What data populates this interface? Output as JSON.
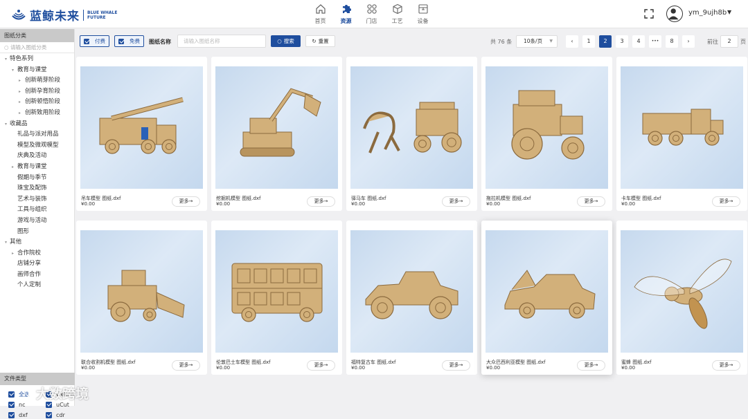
{
  "brand": {
    "name_cn": "蓝鲸未来",
    "name_en_line1": "BLUE WHALE",
    "name_en_line2": "FUTURE",
    "color": "#1f4e9e"
  },
  "nav": [
    {
      "label": "首页",
      "icon": "home-icon"
    },
    {
      "label": "资源",
      "icon": "puzzle-icon",
      "active": true
    },
    {
      "label": "门店",
      "icon": "grid-icon"
    },
    {
      "label": "工艺",
      "icon": "cube-icon"
    },
    {
      "label": "设备",
      "icon": "machine-icon"
    }
  ],
  "user": {
    "name": "ym_9ujh8b"
  },
  "sidebar": {
    "header": "图纸分类",
    "search_placeholder": "请输入图纸分类",
    "tree": [
      {
        "label": "特色系列",
        "level": 0,
        "toggle": "▾"
      },
      {
        "label": "教育与课堂",
        "level": 1,
        "toggle": "▾"
      },
      {
        "label": "创新萌芽阶段",
        "level": 2,
        "toggle": "▸"
      },
      {
        "label": "创新孕育阶段",
        "level": 2,
        "toggle": "▸"
      },
      {
        "label": "创新顿悟阶段",
        "level": 2,
        "toggle": "▸"
      },
      {
        "label": "创新致用阶段",
        "level": 2,
        "toggle": "▸"
      },
      {
        "label": "收藏品",
        "level": 0,
        "toggle": "▾"
      },
      {
        "label": "礼品与派对用品",
        "level": 1,
        "toggle": ""
      },
      {
        "label": "模型及微观模型",
        "level": 1,
        "toggle": ""
      },
      {
        "label": "庆典及活动",
        "level": 1,
        "toggle": ""
      },
      {
        "label": "教育与课堂",
        "level": 1,
        "toggle": "▸"
      },
      {
        "label": "假期与季节",
        "level": 1,
        "toggle": ""
      },
      {
        "label": "珠宝及配饰",
        "level": 1,
        "toggle": ""
      },
      {
        "label": "艺术与装饰",
        "level": 1,
        "toggle": ""
      },
      {
        "label": "工具与组织",
        "level": 1,
        "toggle": ""
      },
      {
        "label": "游戏与活动",
        "level": 1,
        "toggle": ""
      },
      {
        "label": "图形",
        "level": 1,
        "toggle": ""
      },
      {
        "label": "其他",
        "level": 0,
        "toggle": "▾"
      },
      {
        "label": "合作院校",
        "level": 1,
        "toggle": "▸"
      },
      {
        "label": "店铺分享",
        "level": 1,
        "toggle": ""
      },
      {
        "label": "画师合作",
        "level": 1,
        "toggle": ""
      },
      {
        "label": "个人定制",
        "level": 1,
        "toggle": ""
      }
    ],
    "file_type_header": "文件类型",
    "file_types": [
      "全选",
      "websm",
      "nc",
      "uCut",
      "dxf",
      "cdr"
    ]
  },
  "filters": {
    "paid_label": "付费",
    "free_label": "免费",
    "name_label": "图纸名称",
    "name_placeholder": "请输入图纸名称",
    "search_label": "搜索",
    "reset_label": "重置"
  },
  "pagination": {
    "total_text": "共 76 条",
    "page_size": "10条/页",
    "prev": "‹",
    "next": "›",
    "pages": [
      "1",
      "2",
      "3",
      "4",
      "•••",
      "8"
    ],
    "current": "2",
    "goto_label": "前往",
    "goto_value": "2",
    "page_suffix": "页"
  },
  "cards": [
    {
      "title": "吊车模型 图纸.dxf",
      "price": "¥0.00",
      "more": "更多→",
      "art": "crane"
    },
    {
      "title": "挖掘机模型 图纸.dxf",
      "price": "¥0.00",
      "more": "更多→",
      "art": "excavator"
    },
    {
      "title": "驿马车 图纸.dxf",
      "price": "¥0.00",
      "more": "更多→",
      "art": "carriage"
    },
    {
      "title": "拖拉机模型 图纸.dxf",
      "price": "¥0.00",
      "more": "更多→",
      "art": "tractor"
    },
    {
      "title": "卡车模型 图纸.dxf",
      "price": "¥0.00",
      "more": "更多→",
      "art": "truck"
    },
    {
      "title": "联合收割机模型 图纸.dxf",
      "price": "¥0.00",
      "more": "更多→",
      "art": "harvester"
    },
    {
      "title": "伦敦巴士车模型 图纸.dxf",
      "price": "¥0.00",
      "more": "更多→",
      "art": "bus"
    },
    {
      "title": "福特复古车 图纸.dxf",
      "price": "¥0.00",
      "more": "更多→",
      "art": "vintage-car"
    },
    {
      "title": "大众巴西利亚模型 图纸.dxf",
      "price": "¥0.00",
      "more": "更多→",
      "art": "classic-car",
      "highlight": true
    },
    {
      "title": "蜜蜂 图纸.dxf",
      "price": "¥0.00",
      "more": "更多→",
      "art": "bee"
    }
  ],
  "watermark": "大数跨境"
}
